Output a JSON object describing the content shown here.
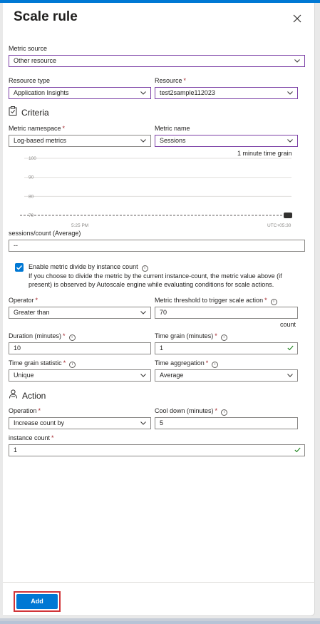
{
  "panel": {
    "title": "Scale rule"
  },
  "metric_source": {
    "label": "Metric source",
    "value": "Other resource"
  },
  "resource_type": {
    "label": "Resource type",
    "value": "Application Insights"
  },
  "resource": {
    "label": "Resource",
    "required": "*",
    "value": "test2sample112023"
  },
  "criteria": {
    "heading": "Criteria"
  },
  "metric_namespace": {
    "label": "Metric namespace",
    "required": "*",
    "value": "Log-based metrics"
  },
  "metric_name": {
    "label": "Metric name",
    "value": "Sessions"
  },
  "chart": {
    "time_grain_note": "1 minute time grain",
    "y_ticks": [
      "100",
      "90",
      "80",
      "70"
    ],
    "x_tick": "5:25 PM",
    "timezone": "UTC+05:30"
  },
  "chart_data": {
    "type": "line",
    "title": "",
    "ylim": [
      70,
      100
    ],
    "y_ticks": [
      100,
      90,
      80,
      70
    ],
    "x_ticks": [
      "5:25 PM"
    ],
    "threshold": 70,
    "grid": true
  },
  "metric_value": {
    "label": "sessions/count (Average)",
    "value": "--"
  },
  "divide": {
    "label": "Enable metric divide by instance count",
    "checked": true,
    "hint_line1": "If you choose to divide the metric by the current instance-count, the metric value above (if",
    "hint_line2": "present) is observed by Autoscale engine while evaluating conditions for scale actions."
  },
  "operator": {
    "label": "Operator",
    "required": "*",
    "value": "Greater than"
  },
  "threshold": {
    "label": "Metric threshold to trigger scale action",
    "required": "*",
    "value": "70",
    "unit": "count"
  },
  "duration": {
    "label": "Duration (minutes)",
    "required": "*",
    "value": "10"
  },
  "time_grain": {
    "label": "Time grain (minutes)",
    "required": "*",
    "value": "1"
  },
  "time_grain_statistic": {
    "label": "Time grain statistic",
    "required": "*",
    "value": "Unique"
  },
  "time_aggregation": {
    "label": "Time aggregation",
    "required": "*",
    "value": "Average"
  },
  "action": {
    "heading": "Action"
  },
  "operation": {
    "label": "Operation",
    "required": "*",
    "value": "Increase count by"
  },
  "cool_down": {
    "label": "Cool down (minutes)",
    "required": "*",
    "value": "5"
  },
  "instance_count": {
    "label": "instance count",
    "required": "*",
    "value": "1"
  },
  "footer": {
    "add_label": "Add"
  },
  "colors": {
    "accent": "#0078d4",
    "required": "#a4262c",
    "valid": "#107c10",
    "highlight_border": "#7b3fa6",
    "callout": "#d13438"
  }
}
